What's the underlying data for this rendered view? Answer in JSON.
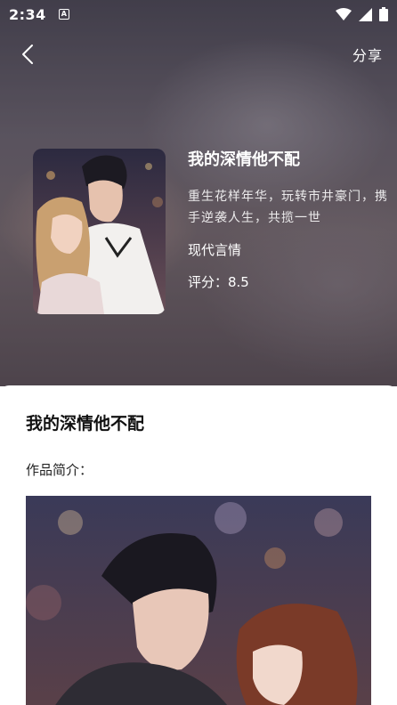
{
  "status_bar": {
    "time": "2:34",
    "app_icon_letter": "A"
  },
  "nav": {
    "share_label": "分享"
  },
  "book": {
    "title": "我的深情他不配",
    "description": "重生花样年华，玩转市井豪门，携手逆袭人生，共揽一世",
    "genre": "现代言情",
    "rating": "评分：8.5"
  },
  "panel": {
    "title": "我的深情他不配",
    "intro_label": "作品简介："
  },
  "icons": {
    "back": "chevron-left-icon",
    "wifi": "wifi-icon",
    "signal": "signal-icon",
    "battery": "battery-icon"
  }
}
